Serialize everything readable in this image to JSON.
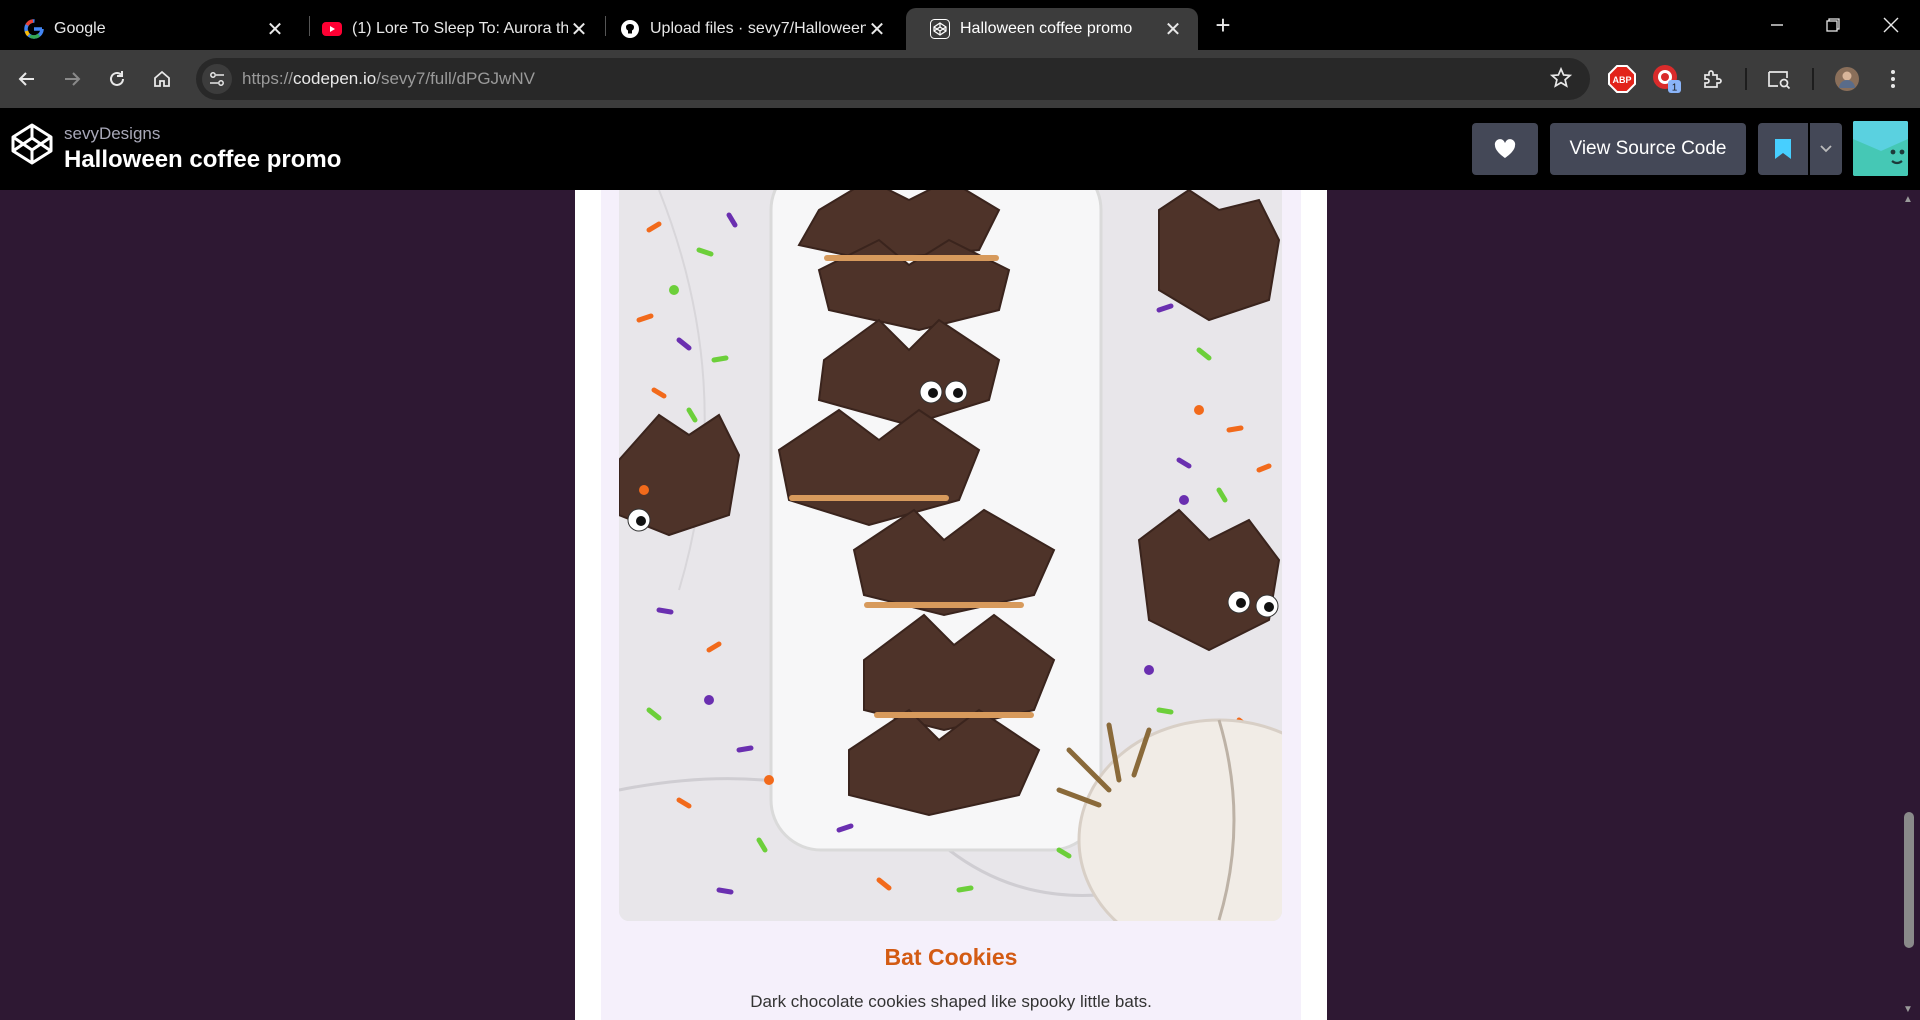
{
  "browser": {
    "tabs": [
      {
        "title": "Google",
        "favicon": "google-icon",
        "active": false
      },
      {
        "title": "(1) Lore To Sleep To: Aurora the",
        "favicon": "youtube-icon",
        "active": false
      },
      {
        "title": "Upload files · sevy7/Halloween-",
        "favicon": "github-icon",
        "active": false
      },
      {
        "title": "Halloween coffee promo",
        "favicon": "codepen-icon",
        "active": true
      }
    ],
    "url_scheme": "https://",
    "url_host": "codepen.io",
    "url_path": "/sevy7/full/dPGJwNV",
    "extension_badge": "1",
    "abp_label": "ABP"
  },
  "codepen": {
    "user": "sevyDesigns",
    "title": "Halloween coffee promo",
    "view_source_label": "View Source Code"
  },
  "product": {
    "name": "Bat Cookies",
    "description": "Dark chocolate cookies shaped like spooky little bats."
  },
  "colors": {
    "page_bg": "#2e1833",
    "card_bg": "#f5f0fb",
    "accent_orange": "#d35b13",
    "codepen_button": "#444857"
  }
}
